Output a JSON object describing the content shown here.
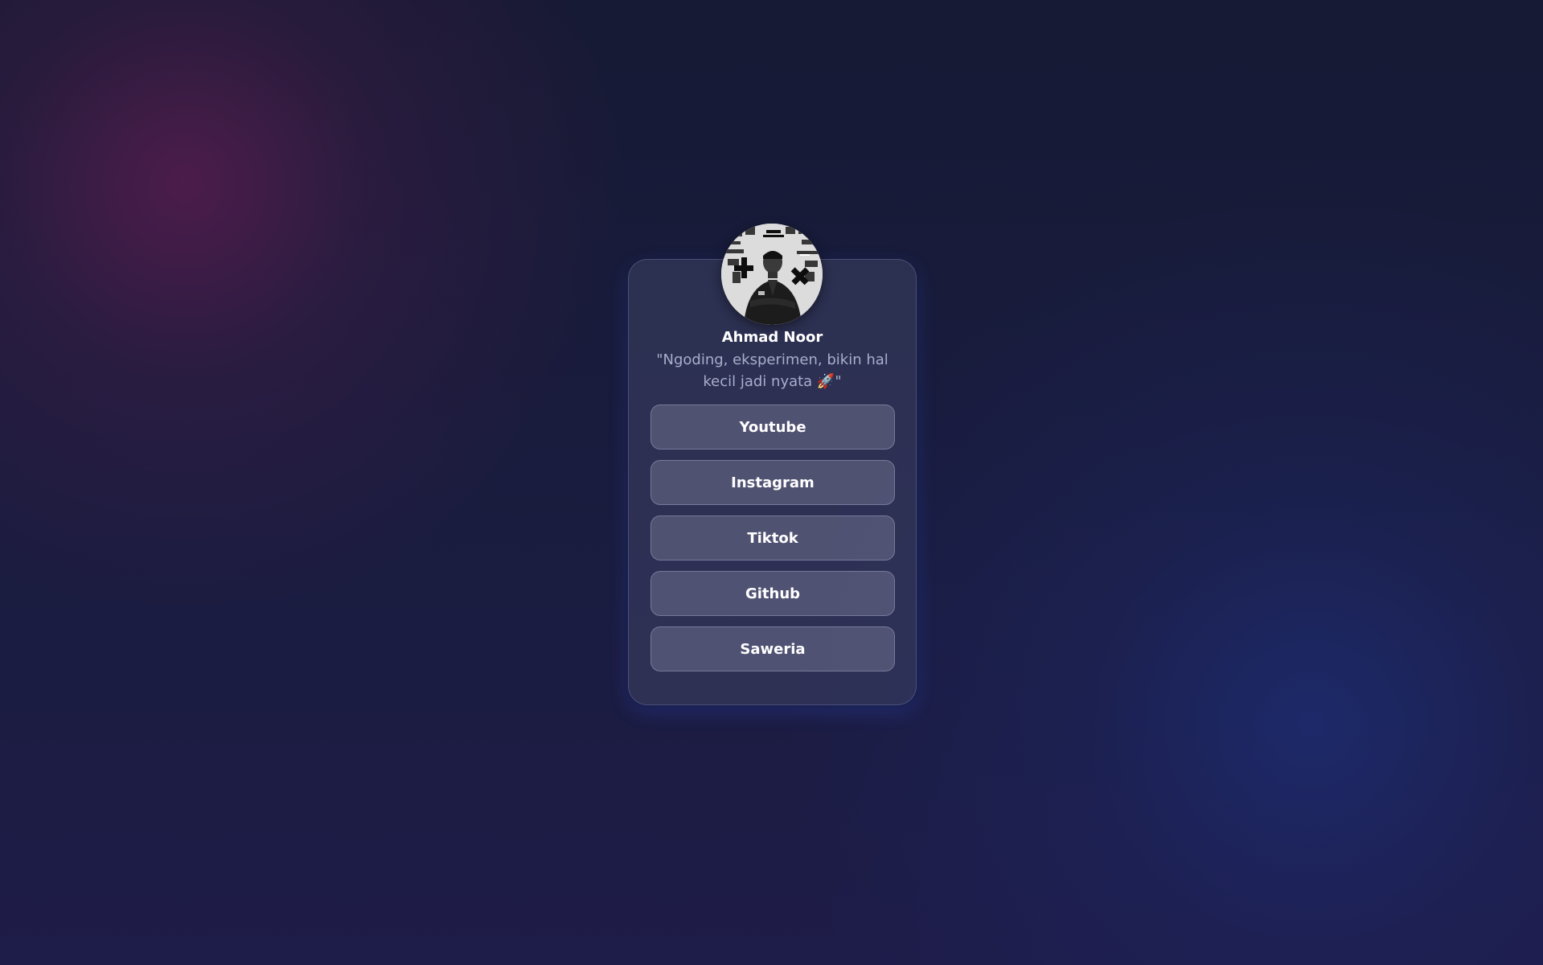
{
  "profile": {
    "name": "Ahmad Noor",
    "bio": "\"Ngoding, eksperimen, bikin hal kecil jadi nyata 🚀\"",
    "avatar": "profile-photo"
  },
  "links": [
    {
      "label": "Youtube"
    },
    {
      "label": "Instagram"
    },
    {
      "label": "Tiktok"
    },
    {
      "label": "Github"
    },
    {
      "label": "Saweria"
    }
  ],
  "colors": {
    "background": "#181b3c",
    "card": "#2e3258",
    "button": "#565873",
    "text": "#ffffff",
    "bio_text": "#a9aecb",
    "glow": "#3c64ff"
  }
}
